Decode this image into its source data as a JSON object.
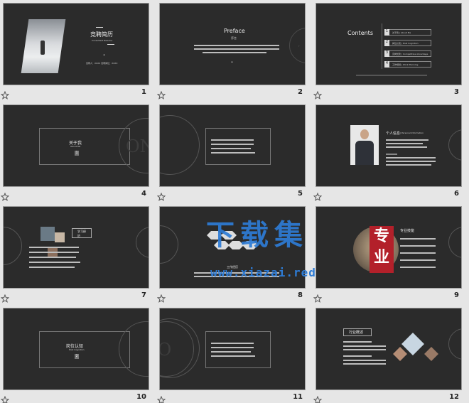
{
  "slides": [
    {
      "number": "1",
      "title": "竞聘简历",
      "subtitle": "Consultant Resume",
      "meta": "竞聘人：XXXX    竞聘岗位：XXXX"
    },
    {
      "number": "2",
      "title": "Preface",
      "subtitle": "序言"
    },
    {
      "number": "3",
      "title": "Contents",
      "items": [
        {
          "n": "1",
          "label": "关于我 | About Me"
        },
        {
          "n": "2",
          "label": "岗位认知 | Post Cognition"
        },
        {
          "n": "3",
          "label": "竞岗优势 | Competitive Advantage"
        },
        {
          "n": "4",
          "label": "工作规划 | Work Planning"
        }
      ]
    },
    {
      "number": "4",
      "title": "关于我",
      "subtitle": "About Me",
      "badge": "1",
      "bg_word": "ONE"
    },
    {
      "number": "5"
    },
    {
      "number": "6",
      "title": "个人信息",
      "subtitle": "| Personal  Information"
    },
    {
      "number": "7",
      "title": "学习经历"
    },
    {
      "number": "8",
      "title": "工作经历"
    },
    {
      "number": "9",
      "title": "专业技能"
    },
    {
      "number": "10",
      "title": "岗位认知",
      "subtitle": "Post Cognition",
      "badge": "2"
    },
    {
      "number": "11",
      "bg_word": "TWO"
    },
    {
      "number": "12",
      "title": "行业概述"
    }
  ],
  "watermark": {
    "main": "下载集",
    "url": "www.xiazai.red",
    "seal": "专业"
  }
}
